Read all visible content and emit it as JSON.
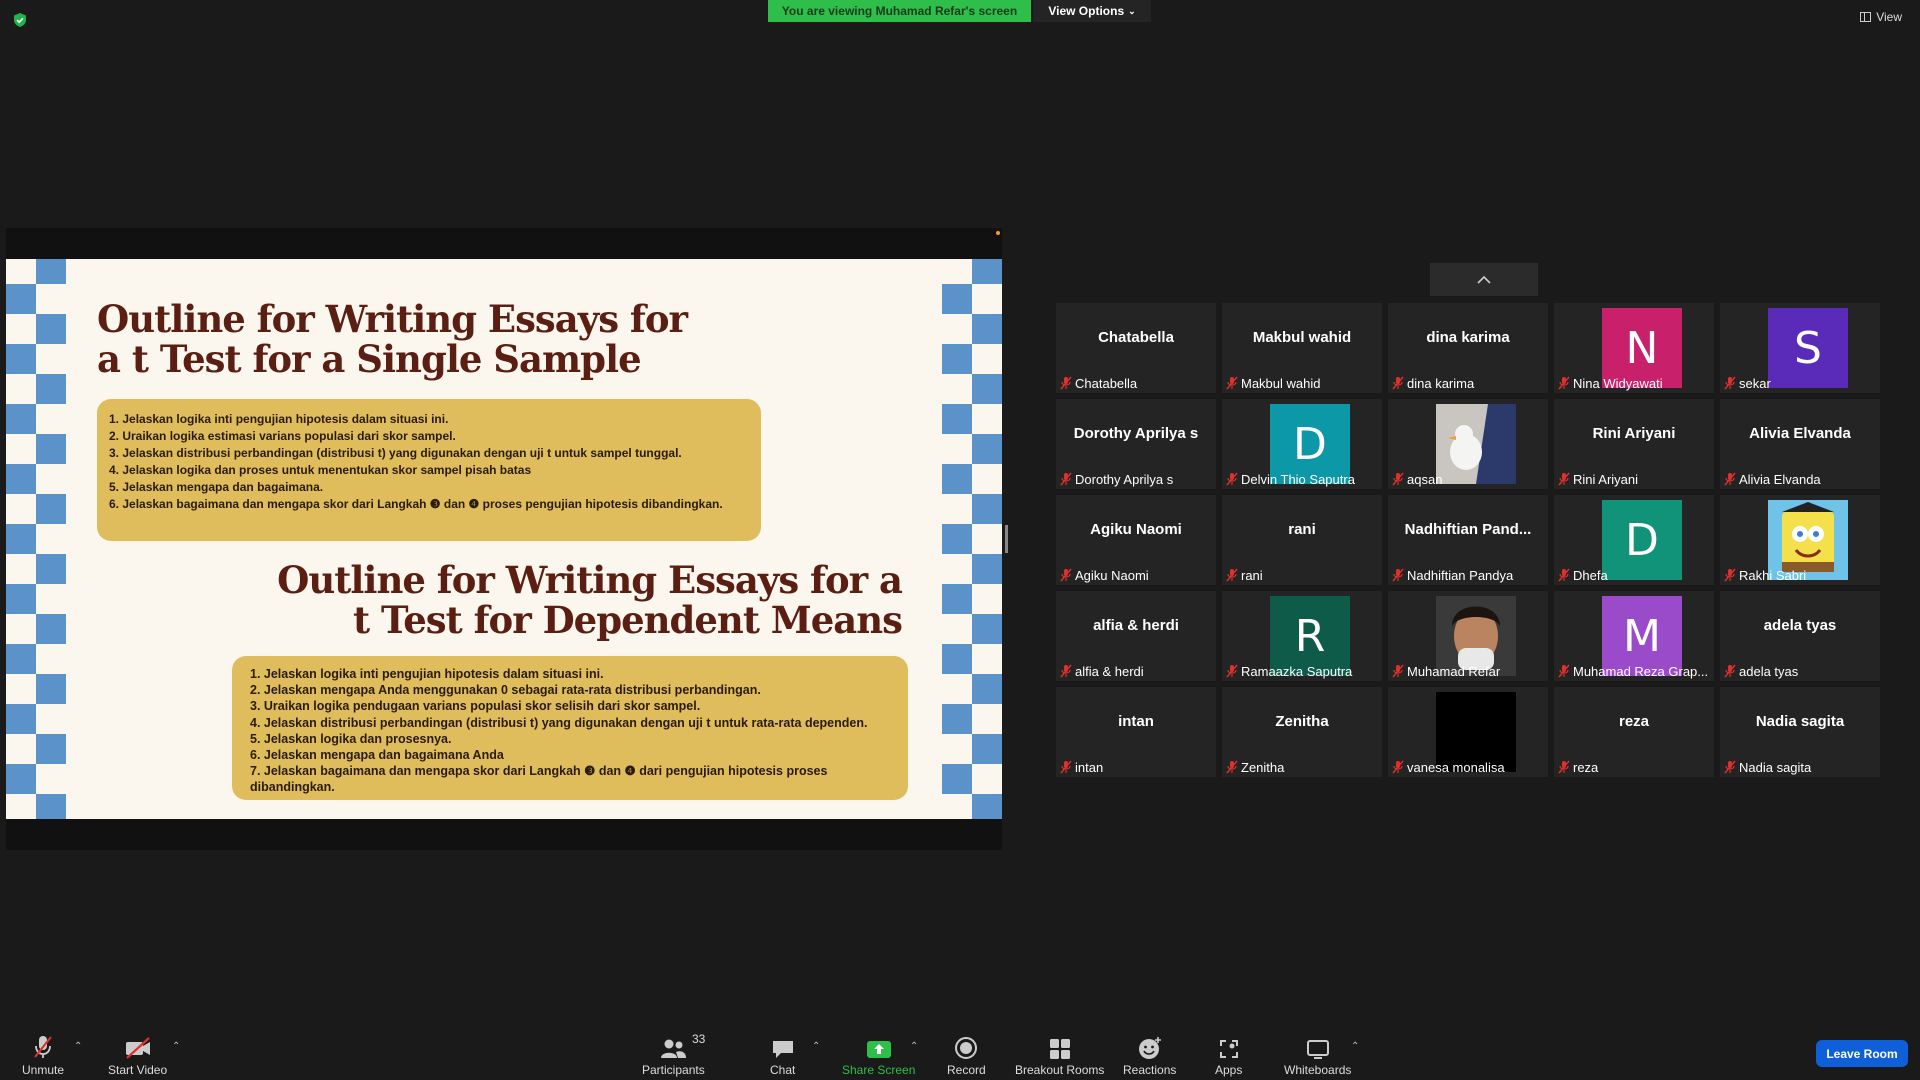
{
  "banner": {
    "sharing_text": "You are viewing Muhamad Refar's screen",
    "view_options_label": "View Options"
  },
  "view_label": "View",
  "slide": {
    "title1": "Outline for Writing Essays for a t Test for a Single Sample",
    "list1": [
      "1. Jelaskan logika inti pengujian hipotesis dalam situasi ini.",
      "2. Uraikan logika estimasi varians populasi dari skor sampel.",
      "3. Jelaskan distribusi perbandingan (distribusi t) yang digunakan dengan uji t untuk sampel tunggal.",
      "4. Jelaskan logika dan proses untuk menentukan skor sampel pisah batas",
      "5. Jelaskan mengapa dan bagaimana.",
      "6. Jelaskan bagaimana dan mengapa skor dari Langkah ❸ dan ❹ proses pengujian hipotesis dibandingkan."
    ],
    "title2": "Outline for Writing Essays for a t Test for Dependent Means",
    "list2": [
      "1. Jelaskan logika inti pengujian hipotesis dalam situasi ini.",
      "2. Jelaskan mengapa Anda menggunakan 0 sebagai rata-rata distribusi perbandingan.",
      "3. Uraikan logika pendugaan varians populasi skor selisih dari skor sampel.",
      "4. Jelaskan distribusi perbandingan (distribusi t) yang digunakan dengan uji t untuk rata-rata dependen.",
      "5. Jelaskan logika dan prosesnya.",
      "6. Jelaskan mengapa dan bagaimana Anda",
      "7. Jelaskan bagaimana dan mengapa skor dari Langkah ❸ dan ❹ dari pengujian hipotesis proses dibandingkan."
    ]
  },
  "participants": [
    {
      "big": "Chatabella",
      "name": "Chatabella"
    },
    {
      "big": "Makbul wahid",
      "name": "Makbul wahid"
    },
    {
      "big": "dina karima",
      "name": "dina karima"
    },
    {
      "avatar": "N",
      "color": "#c8206a",
      "name": "Nina Widyawati"
    },
    {
      "avatar": "S",
      "color": "#5a2ab8",
      "name": "sekar"
    },
    {
      "big": "Dorothy Aprilya s",
      "name": "Dorothy Aprilya s"
    },
    {
      "avatar": "D",
      "color": "#0d98a8",
      "name": "Delvin Thio Saputra"
    },
    {
      "photo": "duck",
      "name": "aqsan"
    },
    {
      "big": "Rini Ariyani",
      "name": "Rini Ariyani"
    },
    {
      "big": "Alivia Elvanda",
      "name": "Alivia Elvanda"
    },
    {
      "big": "Agiku Naomi",
      "name": "Agiku Naomi"
    },
    {
      "big": "rani",
      "name": "rani"
    },
    {
      "big": "Nadhiftian  Pand...",
      "name": "Nadhiftian Pandya"
    },
    {
      "avatar": "D",
      "color": "#11937a",
      "name": "Dhefa"
    },
    {
      "photo": "sponge",
      "name": "Rakhi Sabri"
    },
    {
      "big": "alfia & herdi",
      "name": "alfia & herdi"
    },
    {
      "avatar": "R",
      "color": "#0d5b48",
      "name": "Ramaazka Saputra"
    },
    {
      "photo": "face",
      "name": "Muhamad Refar"
    },
    {
      "avatar": "M",
      "color": "#9a4bc9",
      "name": "Muhamad Reza Grap..."
    },
    {
      "big": "adela tyas",
      "name": "adela tyas"
    },
    {
      "big": "intan",
      "name": "intan"
    },
    {
      "big": "Zenitha",
      "name": "Zenitha"
    },
    {
      "photo": "black",
      "name": "vanesa monalisa"
    },
    {
      "big": "reza",
      "name": "reza"
    },
    {
      "big": "Nadia sagita",
      "name": "Nadia sagita"
    }
  ],
  "toolbar": {
    "unmute": "Unmute",
    "start_video": "Start Video",
    "participants": "Participants",
    "participant_count": "33",
    "chat": "Chat",
    "share_screen": "Share Screen",
    "record": "Record",
    "breakout_rooms": "Breakout Rooms",
    "reactions": "Reactions",
    "apps": "Apps",
    "whiteboards": "Whiteboards",
    "leave": "Leave Room"
  },
  "colors": {
    "share_green": "#2dbf4a",
    "leave_blue": "#0e5fd8",
    "slide_gold": "#dfbd5c",
    "check_blue": "#5b92c9",
    "title_brown": "#5a1f12"
  }
}
